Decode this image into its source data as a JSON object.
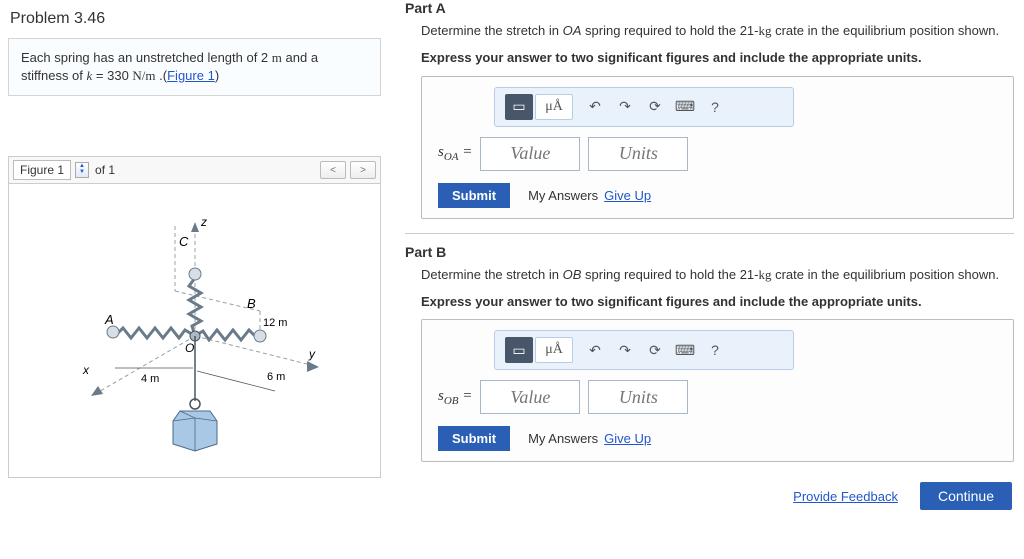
{
  "problem": {
    "title": "Problem 3.46",
    "desc_pre": "Each spring has an unstretched length of 2 ",
    "desc_unit1": "m",
    "desc_mid": " and a stiffness of ",
    "kvar": "k",
    "equals": " = 330 ",
    "desc_unit2": "N/m",
    "desc_post": " .(",
    "fig_link": "Figure 1",
    "desc_close": ")"
  },
  "figure": {
    "label": "Figure 1",
    "of": "of 1",
    "labels": {
      "z": "z",
      "C": "C",
      "A": "A",
      "B": "B",
      "O": "O",
      "x": "x",
      "y": "y",
      "d12": "12 m",
      "d4": "4 m",
      "d6": "6 m"
    }
  },
  "partA": {
    "title": "Part A",
    "q1": "Determine the stretch in ",
    "oa": "OA",
    "q2": " spring required to hold the 21-",
    "kg": "kg",
    "q3": " crate in the equilibrium position shown.",
    "instr": "Express your answer to two significant figures and include the appropriate units.",
    "var_label": "s",
    "var_sub": "OA",
    "eq": " = ",
    "value_ph": "Value",
    "units_ph": "Units",
    "unit_btn": "μÅ",
    "submit": "Submit",
    "myans": "My Answers",
    "giveup": "Give Up"
  },
  "partB": {
    "title": "Part B",
    "q1": "Determine the stretch in ",
    "ob": "OB",
    "q2": " spring required to hold the 21-",
    "kg": "kg",
    "q3": " crate in the equilibrium position shown.",
    "instr": "Express your answer to two significant figures and include the appropriate units.",
    "var_label": "s",
    "var_sub": "OB",
    "eq": " = ",
    "value_ph": "Value",
    "units_ph": "Units",
    "unit_btn": "μÅ",
    "submit": "Submit",
    "myans": "My Answers",
    "giveup": "Give Up"
  },
  "footer": {
    "feedback": "Provide Feedback",
    "continue": "Continue"
  },
  "tooltips": {
    "undo": "↶",
    "redo": "↷",
    "reset": "⟳",
    "keyboard": "⌨",
    "help": "?"
  }
}
